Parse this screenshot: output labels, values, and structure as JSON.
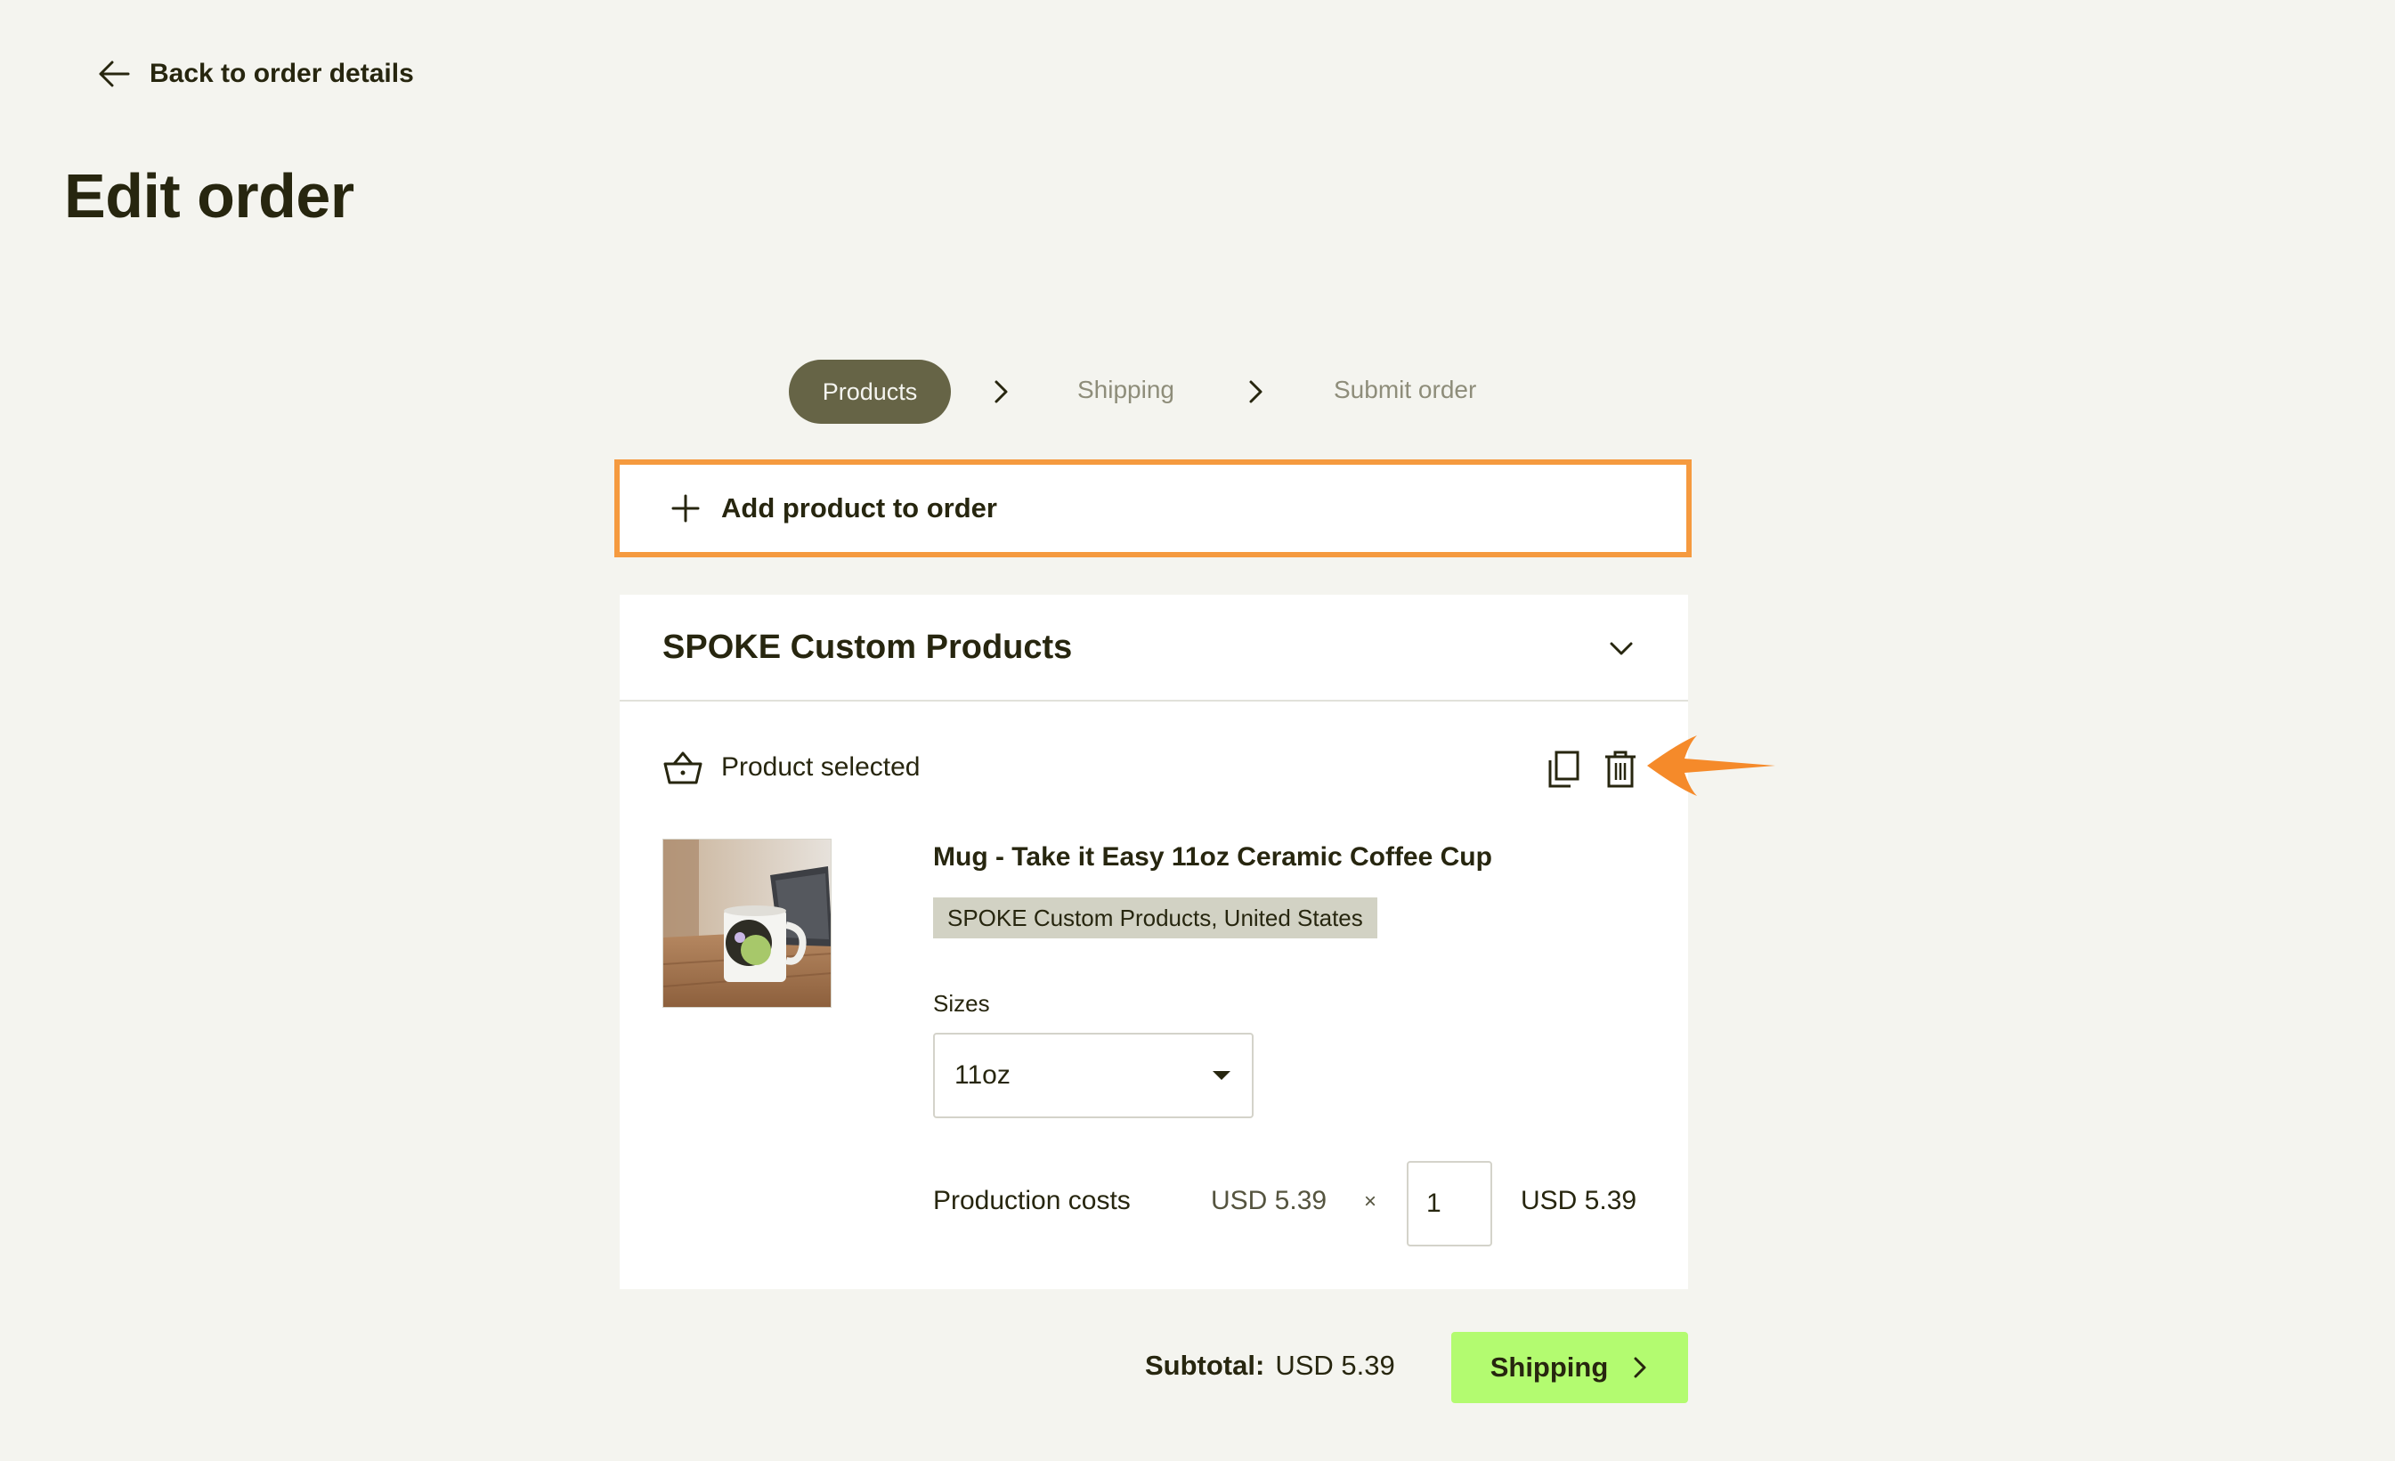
{
  "nav": {
    "back_label": "Back to order details"
  },
  "page": {
    "title": "Edit order"
  },
  "stepper": {
    "steps": [
      {
        "label": "Products",
        "active": true
      },
      {
        "label": "Shipping",
        "active": false
      },
      {
        "label": "Submit order",
        "active": false
      }
    ]
  },
  "add_product": {
    "label": "Add product to order"
  },
  "store": {
    "title": "SPOKE Custom Products",
    "status_label": "Product selected",
    "product": {
      "name": "Mug - Take it Easy 11oz Ceramic Coffee Cup",
      "tag": "SPOKE Custom Products, United States",
      "sizes_label": "Sizes",
      "size_value": "11oz",
      "cost_label": "Production costs",
      "unit_price": "USD 5.39",
      "times": "×",
      "quantity": "1",
      "line_total": "USD 5.39"
    }
  },
  "footer": {
    "subtotal_label": "Subtotal:",
    "subtotal_value": "USD 5.39",
    "next_label": "Shipping"
  },
  "colors": {
    "background": "#f4f4ef",
    "text": "#27260f",
    "active_step": "#666446",
    "highlight_border": "#f59a3f",
    "next_button": "#b3fb70",
    "annotation_arrow": "#f58a2a"
  },
  "icons": {
    "back": "arrow-left-icon",
    "step_separator": "chevron-right-icon",
    "add": "plus-icon",
    "collapse": "chevron-down-icon",
    "selected": "basket-icon",
    "duplicate": "copy-icon",
    "delete": "trash-icon",
    "next": "chevron-right-icon"
  }
}
